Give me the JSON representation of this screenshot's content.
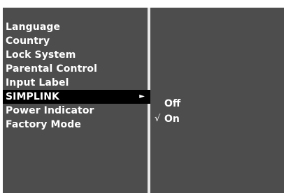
{
  "menu": {
    "items": [
      {
        "label": "Language"
      },
      {
        "label": "Country"
      },
      {
        "label": "Lock System"
      },
      {
        "label": "Parental Control"
      },
      {
        "label": "Input Label"
      },
      {
        "label": "SIMPLINK",
        "selected": true,
        "arrow": "►"
      },
      {
        "label": "Power Indicator"
      },
      {
        "label": "Factory Mode"
      }
    ]
  },
  "submenu": {
    "options": [
      {
        "label": "Off",
        "check": ""
      },
      {
        "label": "On",
        "check": "√"
      }
    ]
  },
  "colors": {
    "panel": "#4d4d4d",
    "selected_row": "#000000",
    "divider": "#e9e9e9",
    "text": "#ffffff"
  }
}
